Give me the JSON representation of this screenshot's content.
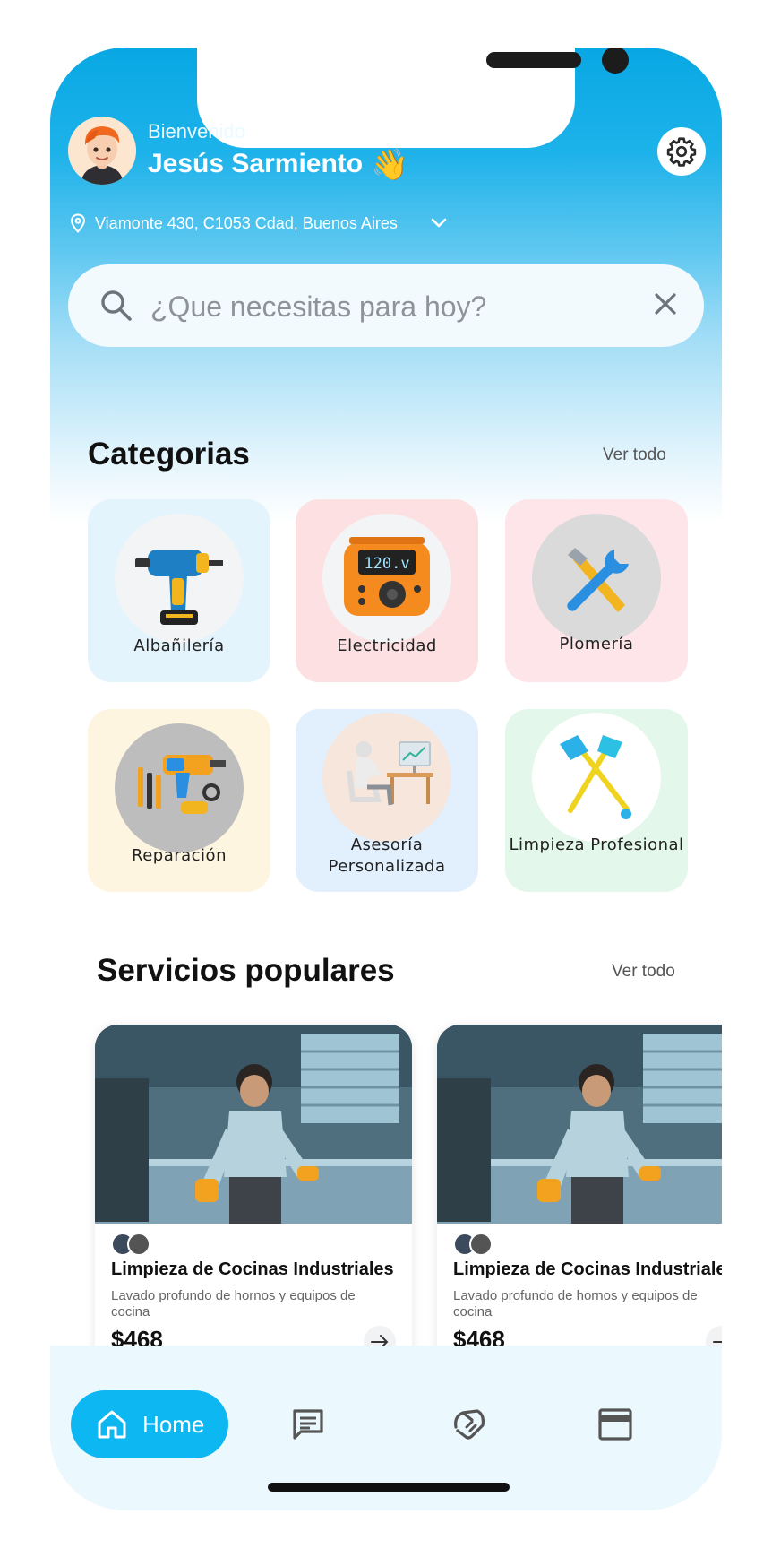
{
  "header": {
    "greeting": "Bienvenido",
    "user_name": "Jesús Sarmiento",
    "wave_emoji": "👋",
    "avatar_icon": "avatar",
    "settings_icon": "gear-icon"
  },
  "location": {
    "address": "Viamonte 430, C1053 Cdad, Buenos Aires",
    "pin_icon": "location-pin-icon",
    "dropdown_icon": "chevron-down-icon"
  },
  "search": {
    "placeholder": "¿Que necesitas para hoy?",
    "value": "",
    "search_icon": "search-icon",
    "clear_icon": "close-icon"
  },
  "categories": {
    "title": "Categorias",
    "see_all": "Ver todo",
    "items": [
      {
        "label": "Albañilería",
        "icon": "drill-icon",
        "bg": "#e4f4fc"
      },
      {
        "label": "Electricidad",
        "icon": "multimeter-icon",
        "bg": "#fde0e2"
      },
      {
        "label": "Plomería",
        "icon": "wrench-screwdriver-icon",
        "bg": "#fde5ea"
      },
      {
        "label": "Reparación",
        "icon": "toolkit-icon",
        "bg": "#fdf5e0"
      },
      {
        "label": "Asesoría Personalizada",
        "icon": "consultant-desk-icon",
        "bg": "#e2effd"
      },
      {
        "label": "Limpieza Profesional",
        "icon": "brush-broom-icon",
        "bg": "#e3f7ea"
      }
    ]
  },
  "popular": {
    "title": "Servicios populares",
    "see_all": "Ver todo",
    "cards": [
      {
        "title": "Limpieza de Cocinas Industriales",
        "description": "Lavado profundo de hornos y equipos de cocina",
        "price": "$468"
      },
      {
        "title": "Limpieza de Cocinas Industriales",
        "description": "Lavado profundo de hornos y equipos de cocina",
        "price": "$468"
      }
    ]
  },
  "tabbar": {
    "home_label": "Home",
    "tabs": [
      "home-icon",
      "chat-icon",
      "handshake-icon",
      "card-icon"
    ]
  },
  "colors": {
    "primary": "#0db7f2",
    "header_gradient_top": "#08a8e4"
  }
}
